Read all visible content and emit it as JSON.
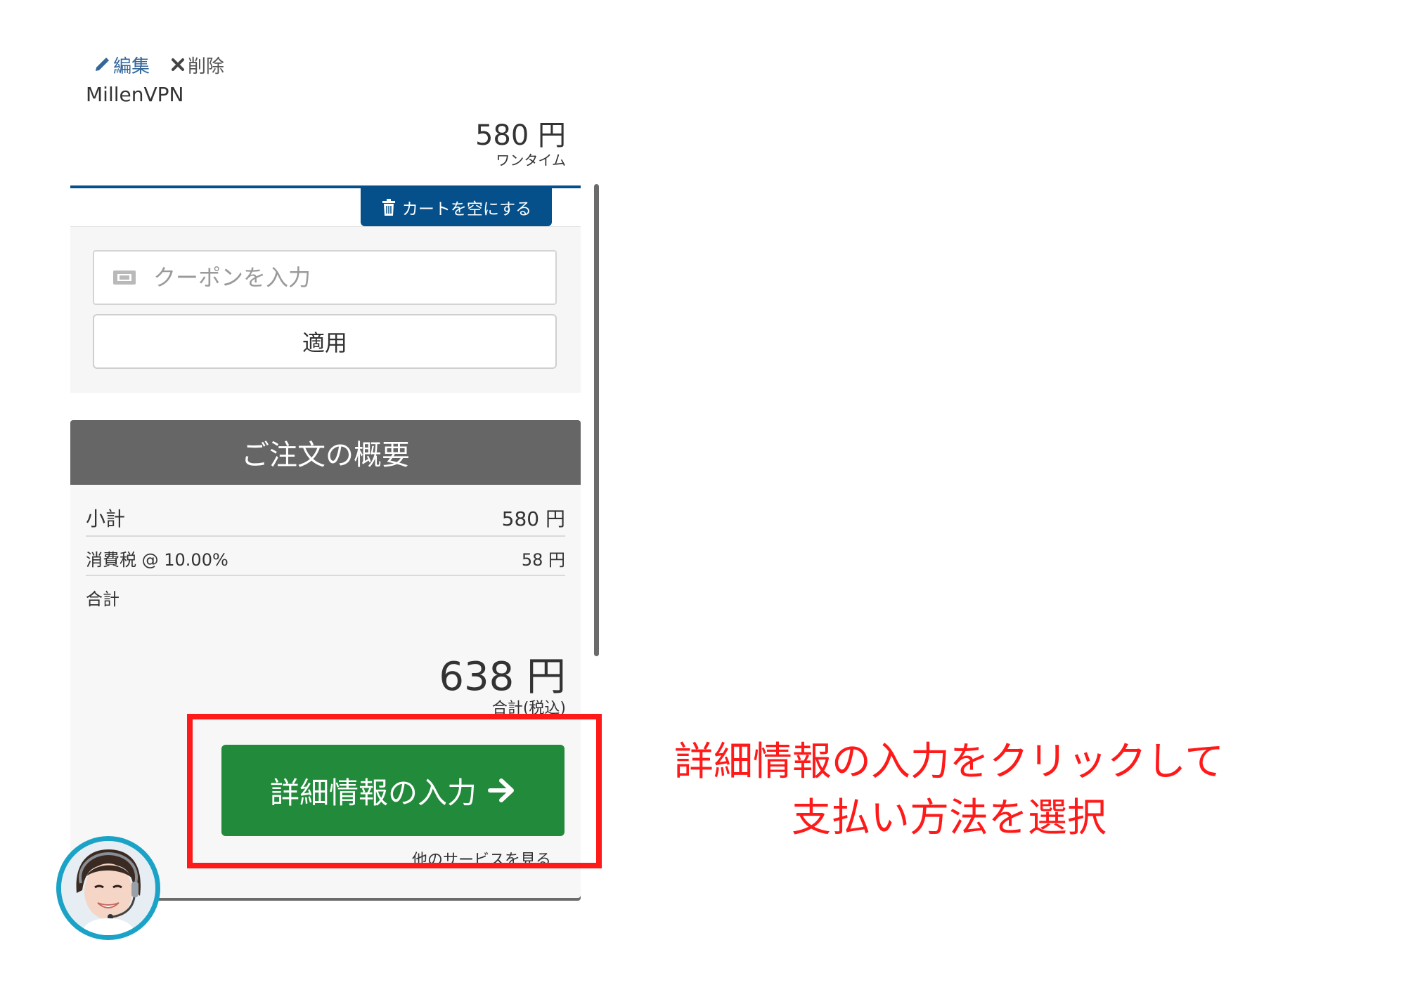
{
  "item": {
    "edit_label": "編集",
    "delete_label": "削除",
    "name": "MillenVPN",
    "price": "580 円",
    "billing_cycle": "ワンタイム"
  },
  "cart": {
    "empty_label": "カートを空にする"
  },
  "coupon": {
    "placeholder": "クーポンを入力",
    "apply_label": "適用"
  },
  "summary": {
    "title": "ご注文の概要",
    "subtotal_label": "小計",
    "subtotal_value": "580 円",
    "tax_label": "消費税 @ 10.00%",
    "tax_value": "58 円",
    "total_label": "合計",
    "total_amount": "638 円",
    "total_note": "合計(税込)"
  },
  "checkout": {
    "button_label": "詳細情報の入力",
    "other_services": "他のサービスを見る"
  },
  "annotation": {
    "line1": "詳細情報の入力をクリックして",
    "line2": "支払い方法を選択"
  },
  "colors": {
    "accent_blue": "#05508a",
    "checkout_green": "#228a3b",
    "highlight_red": "#ff1a1a",
    "summary_header": "#666666"
  }
}
